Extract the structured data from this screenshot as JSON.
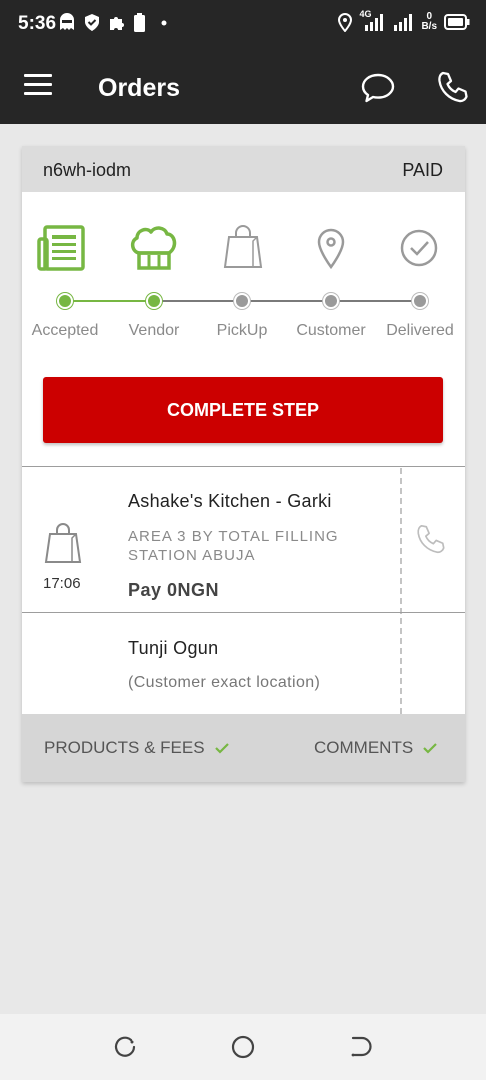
{
  "status_bar": {
    "time": "5:36",
    "network_type": "4G",
    "data_speed_value": "0",
    "data_speed_unit": "B/s",
    "icons": [
      "ghost-icon",
      "shield-icon",
      "puzzle-icon",
      "battery-small-icon",
      "dot-icon",
      "location-icon",
      "signal-icon",
      "signal-icon",
      "battery-icon"
    ]
  },
  "app_bar": {
    "title": "Orders",
    "icons": [
      "menu-icon",
      "chat-icon",
      "phone-icon"
    ]
  },
  "order": {
    "id": "n6wh-iodm",
    "payment_status": "PAID",
    "steps": [
      {
        "label": "Accepted",
        "icon": "order-list-icon",
        "done": true
      },
      {
        "label": "Vendor",
        "icon": "chef-hat-icon",
        "done": true
      },
      {
        "label": "PickUp",
        "icon": "shopping-bag-icon",
        "done": false
      },
      {
        "label": "Customer",
        "icon": "location-pin-icon",
        "done": false
      },
      {
        "label": "Delivered",
        "icon": "check-circle-icon",
        "done": false
      }
    ],
    "complete_button_label": "COMPLETE STEP",
    "pickup": {
      "time": "17:06",
      "vendor_name": "Ashake's Kitchen - Garki",
      "address": "AREA 3 BY TOTAL FILLING STATION ABUJA",
      "pay": "Pay 0NGN"
    },
    "dropoff": {
      "customer_name": "Tunji Ogun",
      "location": "(Customer exact location)"
    },
    "footer": {
      "products_label": "PRODUCTS & FEES",
      "comments_label": "COMMENTS"
    }
  },
  "colors": {
    "accent_green": "#77b743",
    "button_red": "#cc0000",
    "header_dark": "#262626"
  }
}
